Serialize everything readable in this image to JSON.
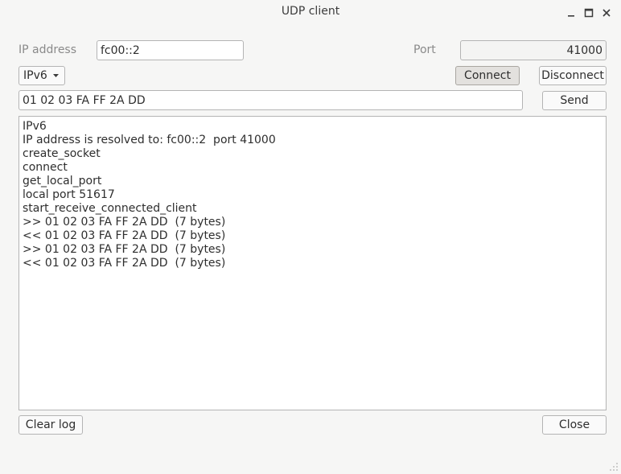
{
  "window": {
    "title": "UDP client",
    "minimize_icon": "minimize-icon",
    "maximize_icon": "maximize-icon",
    "close_icon": "close-icon"
  },
  "connection": {
    "ip_label": "IP address",
    "ip_value": "fc00::2",
    "port_label": "Port",
    "port_value": "41000",
    "protocol_selected": "IPv6",
    "connect_label": "Connect",
    "disconnect_label": "Disconnect"
  },
  "message": {
    "value": "01 02 03 FA FF 2A DD",
    "send_label": "Send"
  },
  "log": {
    "lines": [
      "IPv6",
      "IP address is resolved to: fc00::2  port 41000",
      "create_socket",
      "connect",
      "get_local_port",
      "local port 51617",
      "start_receive_connected_client",
      ">> 01 02 03 FA FF 2A DD  (7 bytes)",
      "<< 01 02 03 FA FF 2A DD  (7 bytes)",
      ">> 01 02 03 FA FF 2A DD  (7 bytes)",
      "<< 01 02 03 FA FF 2A DD  (7 bytes)"
    ]
  },
  "footer": {
    "clear_log_label": "Clear log",
    "close_label": "Close"
  }
}
